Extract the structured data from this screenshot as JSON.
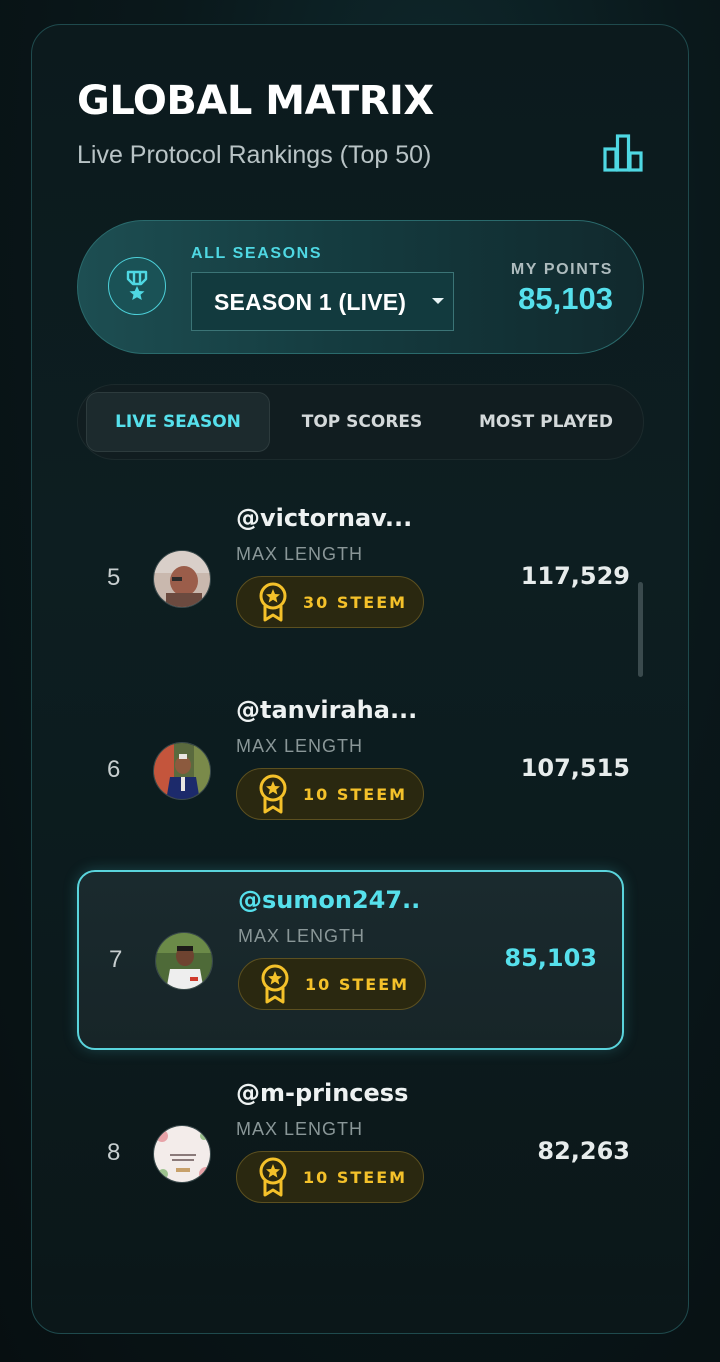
{
  "header": {
    "title": "GLOBAL MATRIX",
    "subtitle": "Live Protocol Rankings (Top 50)"
  },
  "season": {
    "label": "ALL SEASONS",
    "selected": "SEASON 1 (LIVE)",
    "my_points_label": "MY POINTS",
    "my_points_value": "85,103"
  },
  "tabs": [
    {
      "label": "LIVE SEASON",
      "active": true
    },
    {
      "label": "TOP SCORES",
      "active": false
    },
    {
      "label": "MOST PLAYED",
      "active": false
    }
  ],
  "rows": [
    {
      "rank": "5",
      "username": "@victornav...",
      "mode": "MAX LENGTH",
      "reward": "30 STEEM",
      "score": "117,529",
      "self": false
    },
    {
      "rank": "6",
      "username": "@tanviraha...",
      "mode": "MAX LENGTH",
      "reward": "10 STEEM",
      "score": "107,515",
      "self": false
    },
    {
      "rank": "7",
      "username": "@sumon247..",
      "mode": "MAX LENGTH",
      "reward": "10 STEEM",
      "score": "85,103",
      "self": true
    },
    {
      "rank": "8",
      "username": "@m-princess",
      "mode": "MAX LENGTH",
      "reward": "10 STEEM",
      "score": "82,263",
      "self": false
    }
  ],
  "colors": {
    "accent": "#56e0ec",
    "reward_gold": "#f4c12a",
    "panel_border": "#1f4a4d"
  },
  "icons": {
    "header": "bar-chart-icon",
    "season": "medal-icon",
    "reward": "award-ribbon-icon"
  }
}
